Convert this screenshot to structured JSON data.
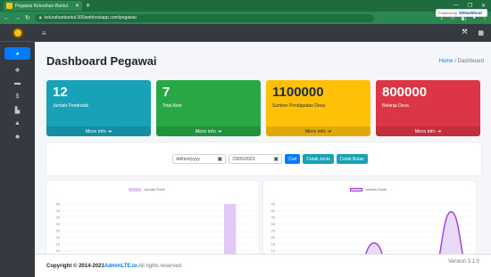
{
  "browser": {
    "tab_title": "Pegawai Kelurahan Bantul",
    "url": "kelurahanbantul.000webhostapp.com/pegawai"
  },
  "header": {
    "title": "Dashboard Pegawai",
    "breadcrumb_home": "Home",
    "breadcrumb_sep": " / ",
    "breadcrumb_current": "Dashboard"
  },
  "stats": [
    {
      "value": "12",
      "label": "Jumlah Penduduk",
      "more": "More info",
      "color": "#17a2b8"
    },
    {
      "value": "7",
      "label": "Total Aset",
      "more": "More info",
      "color": "#28a745"
    },
    {
      "value": "1100000",
      "label": "Sumber Pendapatan Desa",
      "more": "More info",
      "color": "#ffc107"
    },
    {
      "value": "800000",
      "label": "Belanja Desa",
      "more": "More info",
      "color": "#dc3545"
    }
  ],
  "filter": {
    "date_from_placeholder": "dd/mm/yyyy",
    "date_to_value": "23/05/2023",
    "btn_cari": "Cari",
    "btn_cetak_jenis": "Cetak Jenis",
    "btn_cetak_bulan": "Cetak Bulan"
  },
  "chart_data": [
    {
      "type": "bar",
      "title": "",
      "series": [
        {
          "name": "Jumlah Surat",
          "color": "#e2c9f5",
          "values": [
            0,
            0,
            0,
            0,
            0,
            0,
            0,
            0,
            0,
            0,
            45,
            0
          ]
        }
      ],
      "yticks": [
        "45",
        "40",
        "35",
        "30",
        "25",
        "20",
        "15",
        "10"
      ],
      "ylim": [
        0,
        45
      ],
      "grid": true,
      "legend": "top"
    },
    {
      "type": "line",
      "title": "",
      "series": [
        {
          "name": "Jumlah Surat",
          "color": "#9b3fd8",
          "values": [
            0,
            0,
            0,
            0,
            0,
            20,
            0,
            0,
            0,
            40,
            0
          ]
        }
      ],
      "yticks": [
        "45",
        "40",
        "35",
        "30",
        "25",
        "20",
        "15",
        "10"
      ],
      "ylim": [
        0,
        45
      ],
      "grid": true,
      "legend": "top"
    }
  ],
  "footer": {
    "copyright": "Copyright © 2014-2021 ",
    "brand": "AdminLTE.io.",
    "rights": " All rights reserved.",
    "version": "Version 3.1.0",
    "powered_by": "Powered by",
    "host": "000webhost"
  },
  "icons": [
    "brand-logo-icon",
    "dashboard-icon",
    "users-icon",
    "mail-icon",
    "dollar-icon",
    "building-icon",
    "lock-icon",
    "settings-icon",
    "menu-icon",
    "expand-icon",
    "grid-icon",
    "arrow-circle-right-icon",
    "calendar-icon"
  ]
}
